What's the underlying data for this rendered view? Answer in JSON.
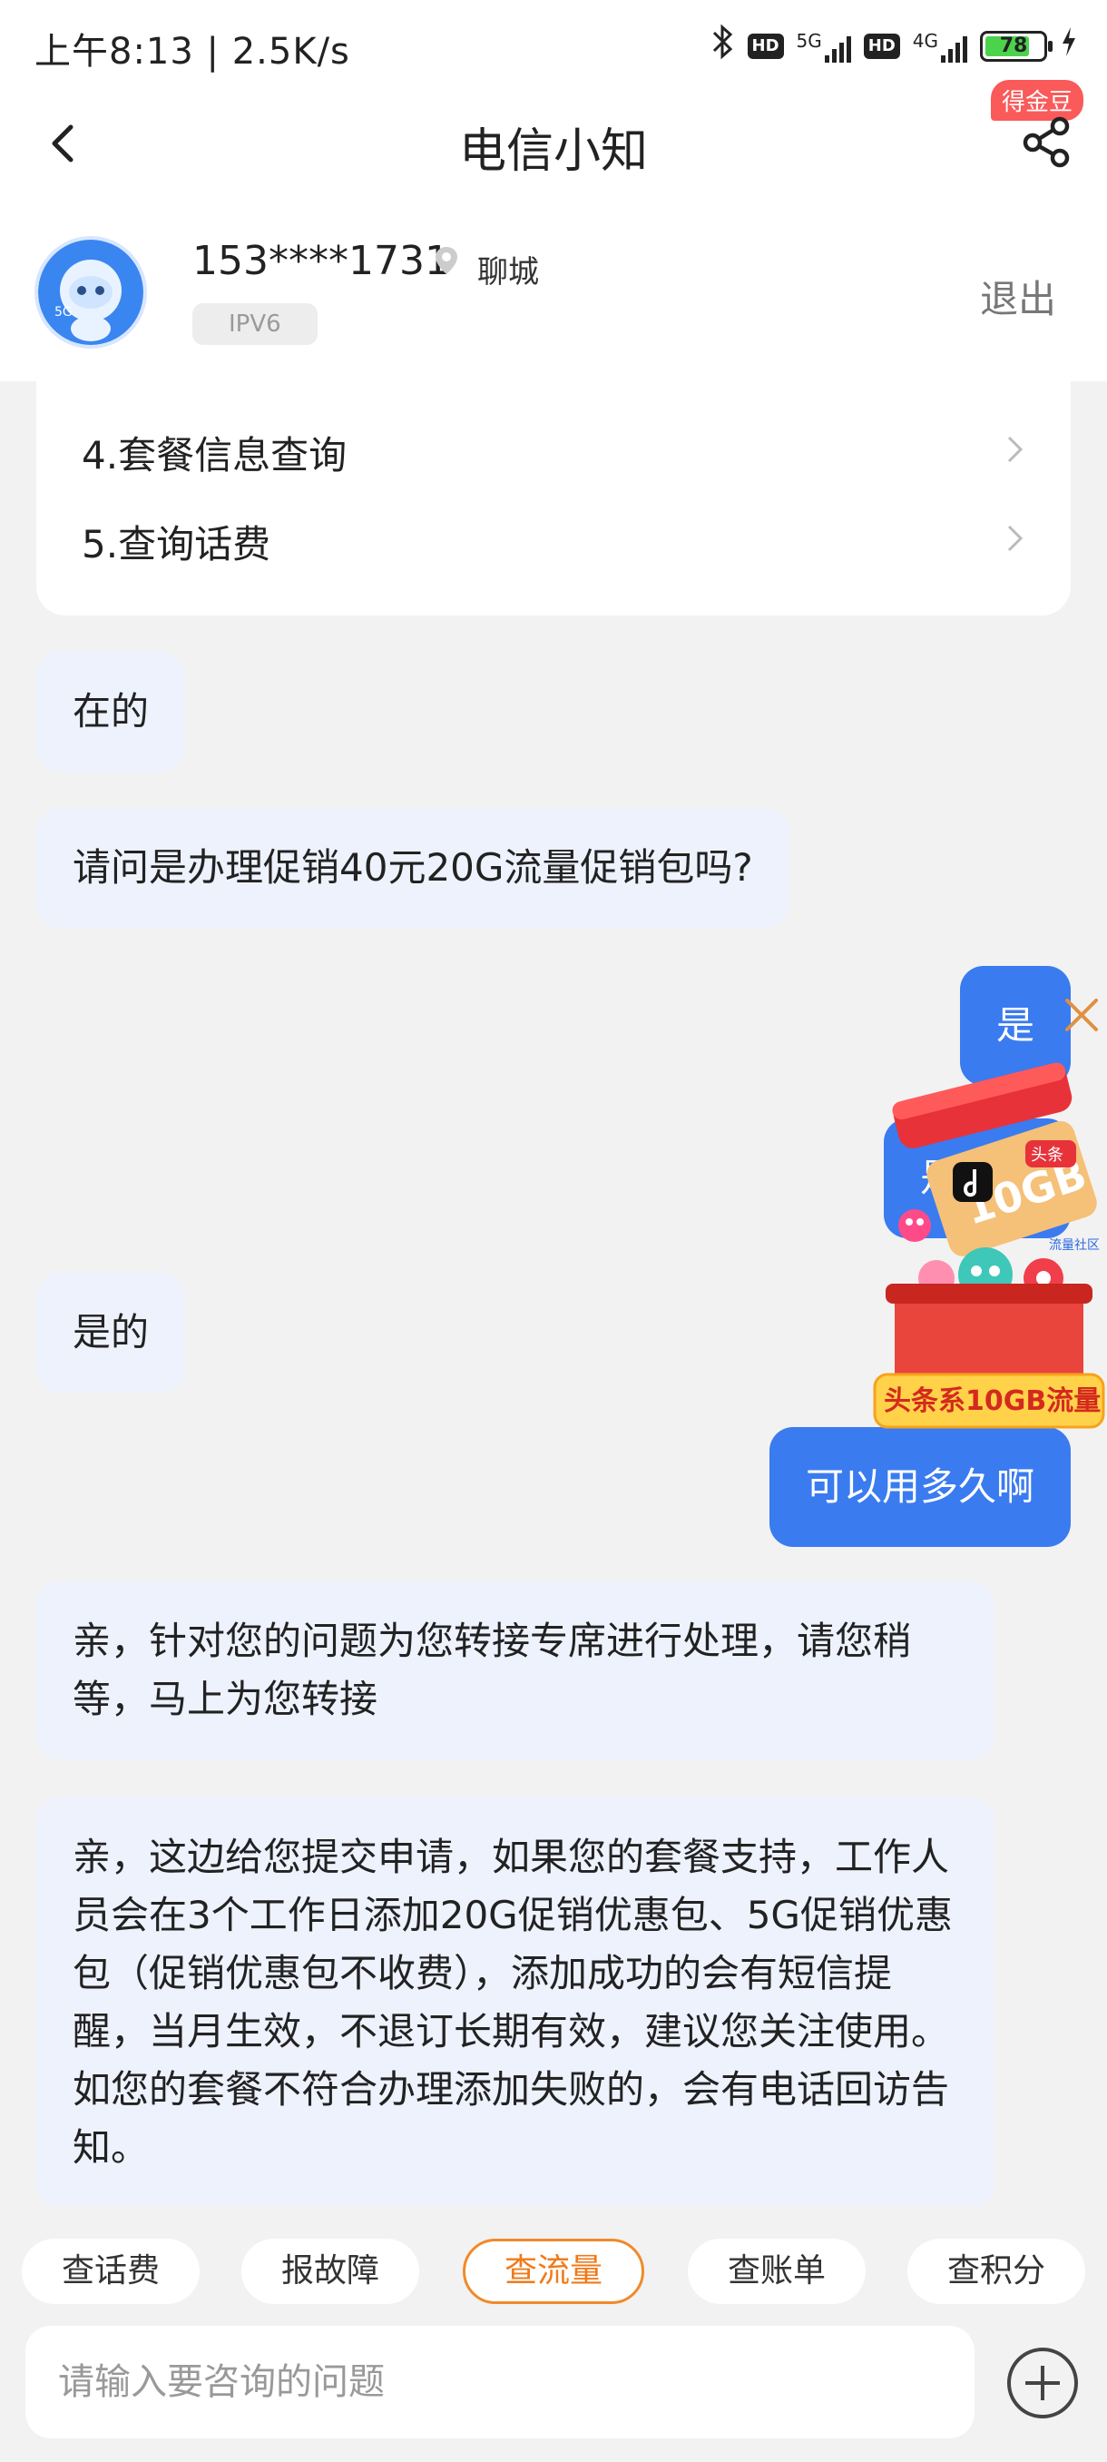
{
  "status_bar": {
    "time_speed": "上午8:13 | 2.5K/s",
    "hd": "HD",
    "net1": "5G",
    "net2": "4G",
    "battery": "78",
    "battery_level": 0.78,
    "icons": [
      "bluetooth-icon",
      "signal-icon",
      "battery-icon",
      "charging-icon"
    ]
  },
  "nav": {
    "title": "电信小知",
    "badge": "得金豆",
    "icons": [
      "back-arrow-icon",
      "share-icon"
    ]
  },
  "user": {
    "phone": "153****1731",
    "city": "聊城",
    "tag": "IPV6",
    "logout": "退出",
    "avatar_icon": "robot-mascot-icon"
  },
  "menu": {
    "items": [
      {
        "label": "4.套餐信息查询"
      },
      {
        "label": "5.查询话费"
      }
    ]
  },
  "messages": [
    {
      "from": "bot",
      "text": "在的"
    },
    {
      "from": "bot",
      "text": "请问是办理促销40元20G流量促销包吗?"
    },
    {
      "from": "user",
      "text": "是"
    },
    {
      "from": "user",
      "text": "是免费"
    },
    {
      "from": "bot",
      "text": "是的"
    },
    {
      "from": "user",
      "text": "可以用多久啊"
    },
    {
      "from": "bot",
      "text": "亲，针对您的问题为您转接专席进行处理，请您稍等，马上为您转接"
    },
    {
      "from": "bot",
      "text": "亲，这边给您提交申请，如果您的套餐支持，工作人员会在3个工作日添加20G促销优惠包、5G促销优惠包（促销优惠包不收费），添加成功的会有短信提醒，当月生效，不退订长期有效，建议您关注使用。如您的套餐不符合办理添加失败的，会有电话回访告知。"
    }
  ],
  "promo": {
    "banner": "头条系10GB流量",
    "box_text": "10GB",
    "tag": "头条",
    "side": "流量社区"
  },
  "quick_actions": [
    {
      "label": "查话费"
    },
    {
      "label": "报故障"
    },
    {
      "label": "查流量",
      "active": true
    },
    {
      "label": "查账单"
    },
    {
      "label": "查积分"
    }
  ],
  "input": {
    "placeholder": "请输入要咨询的问题",
    "value": ""
  },
  "colors": {
    "accent": "#3a7bf0",
    "bot_bubble": "#eef2fd",
    "badge": "#fa5a5a",
    "active_chip": "#f08a2a"
  }
}
